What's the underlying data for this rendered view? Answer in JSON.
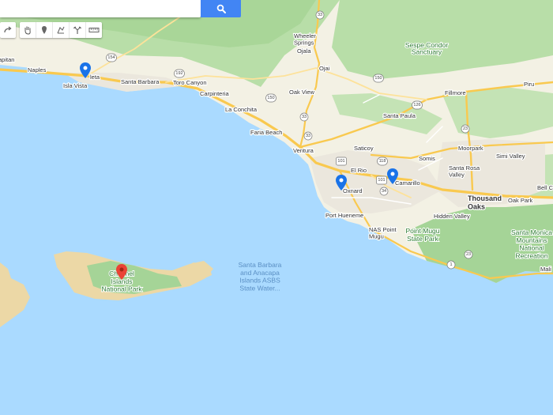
{
  "search": {
    "placeholder": "",
    "value": ""
  },
  "toolbar": {
    "icons": [
      "redo-icon",
      "hand-pan-icon",
      "add-marker-icon",
      "draw-line-icon",
      "directions-icon",
      "measure-ruler-icon"
    ]
  },
  "colors": {
    "water": "#aadaff",
    "land": "#f3f1e4",
    "park": "#c4e3b5",
    "forest": "#a5d497",
    "urban": "#ebe7dd",
    "highway": "#f9c94f",
    "marker_blue": "#1a73e8",
    "marker_red": "#ea4335",
    "search_button": "#4285f4"
  },
  "places": {
    "capitan": "apitan",
    "naples": "Naples",
    "goleta": "leta",
    "isla_vista": "Isla Vista",
    "santa_barbara": "Santa Barbara",
    "toro_canyon": "Toro Canyon",
    "carpinteria": "Carpinteria",
    "la_conchita": "La Conchita",
    "faria_beach": "Faria Beach",
    "ventura": "Ventura",
    "wheeler_springs": "Wheeler\nSprings",
    "ojala": "Ojala",
    "ojai": "Ojai",
    "oak_view": "Oak View",
    "sespe": "Sespe Condor\nSanctuary",
    "fillmore": "Fillmore",
    "piru": "Piru",
    "santa_paula": "Santa Paula",
    "saticoy": "Saticoy",
    "el_rio": "El Rio",
    "oxnard": "Oxnard",
    "camarillo": "Camarillo",
    "somis": "Somis",
    "moorpark": "Moorpark",
    "simi_valley": "Simi Valley",
    "santa_rosa_valley": "Santa Rosa\nValley",
    "thousand_oaks": "Thousand\nOaks",
    "oak_park": "Oak Park",
    "bell_c": "Bell C",
    "hidden_valley": "Hidden Valley",
    "port_hueneme": "Port Hueneme",
    "nas_point_mugu": "NAS Point\nMugu",
    "point_mugu_park": "Point Mugu\nState Park",
    "santa_monica_mtns": "Santa Monica\nMountains\nNational\nRecreation",
    "mali": "Mali",
    "recreation": "Recreation",
    "channel_islands": "Channel\nIslands\nNational Park",
    "asbs": "Santa Barbara\nand Anacapa\nIslands ASBS\nState Water..."
  },
  "route_numbers": [
    "33",
    "150",
    "192",
    "154",
    "126",
    "118",
    "101",
    "34",
    "23",
    "1"
  ],
  "markers": [
    {
      "name": "marker-goleta",
      "color": "blue"
    },
    {
      "name": "marker-oxnard",
      "color": "blue"
    },
    {
      "name": "marker-camarillo",
      "color": "blue"
    },
    {
      "name": "marker-channel-islands",
      "color": "red"
    }
  ]
}
